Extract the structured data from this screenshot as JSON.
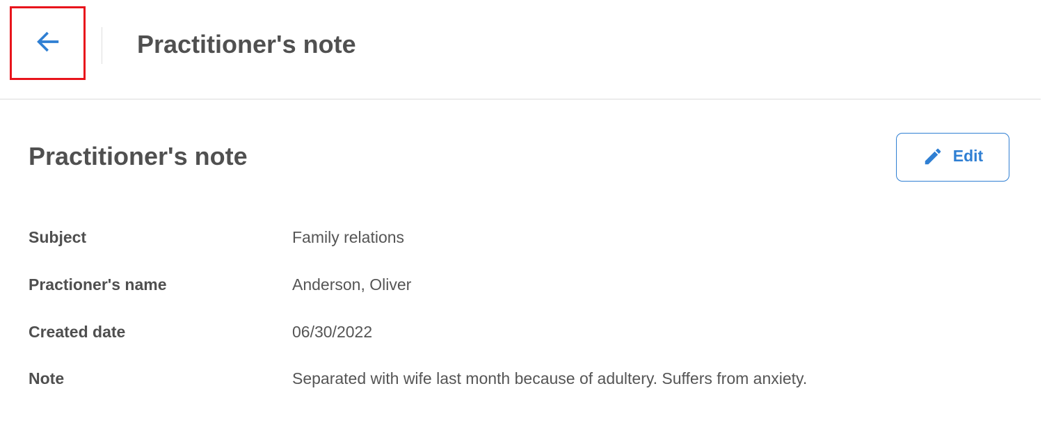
{
  "header": {
    "back_icon": "arrow-left-icon",
    "title": "Practitioner's note"
  },
  "section": {
    "title": "Practitioner's note",
    "edit_icon": "pencil-icon",
    "edit_label": "Edit"
  },
  "details": [
    {
      "label": "Subject",
      "value": "Family relations"
    },
    {
      "label": "Practioner's name",
      "value": "Anderson, Oliver"
    },
    {
      "label": "Created date",
      "value": "06/30/2022"
    },
    {
      "label": "Note",
      "value": "Separated with wife last month because of adultery. Suffers from anxiety."
    }
  ],
  "colors": {
    "accent": "#2f7fd3",
    "highlight_box": "#e8141c",
    "text_dark": "#505050",
    "divider": "#dcdcdc"
  }
}
